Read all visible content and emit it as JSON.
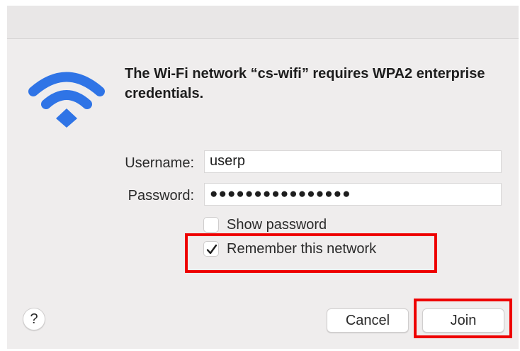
{
  "dialog": {
    "heading": "The Wi-Fi network “cs-wifi” requires WPA2 enterprise credentials.",
    "wifi_icon": "wifi-icon",
    "accent_color": "#2f74e6"
  },
  "form": {
    "username_label": "Username:",
    "username_value": "userp",
    "password_label": "Password:",
    "password_value": "●●●●●●●●●●●●●●●●"
  },
  "options": {
    "show_password_label": "Show password",
    "show_password_checked": false,
    "remember_label": "Remember this network",
    "remember_checked": true
  },
  "buttons": {
    "help_label": "?",
    "cancel_label": "Cancel",
    "join_label": "Join"
  },
  "annotations": {
    "highlight_color": "#ee0000"
  }
}
